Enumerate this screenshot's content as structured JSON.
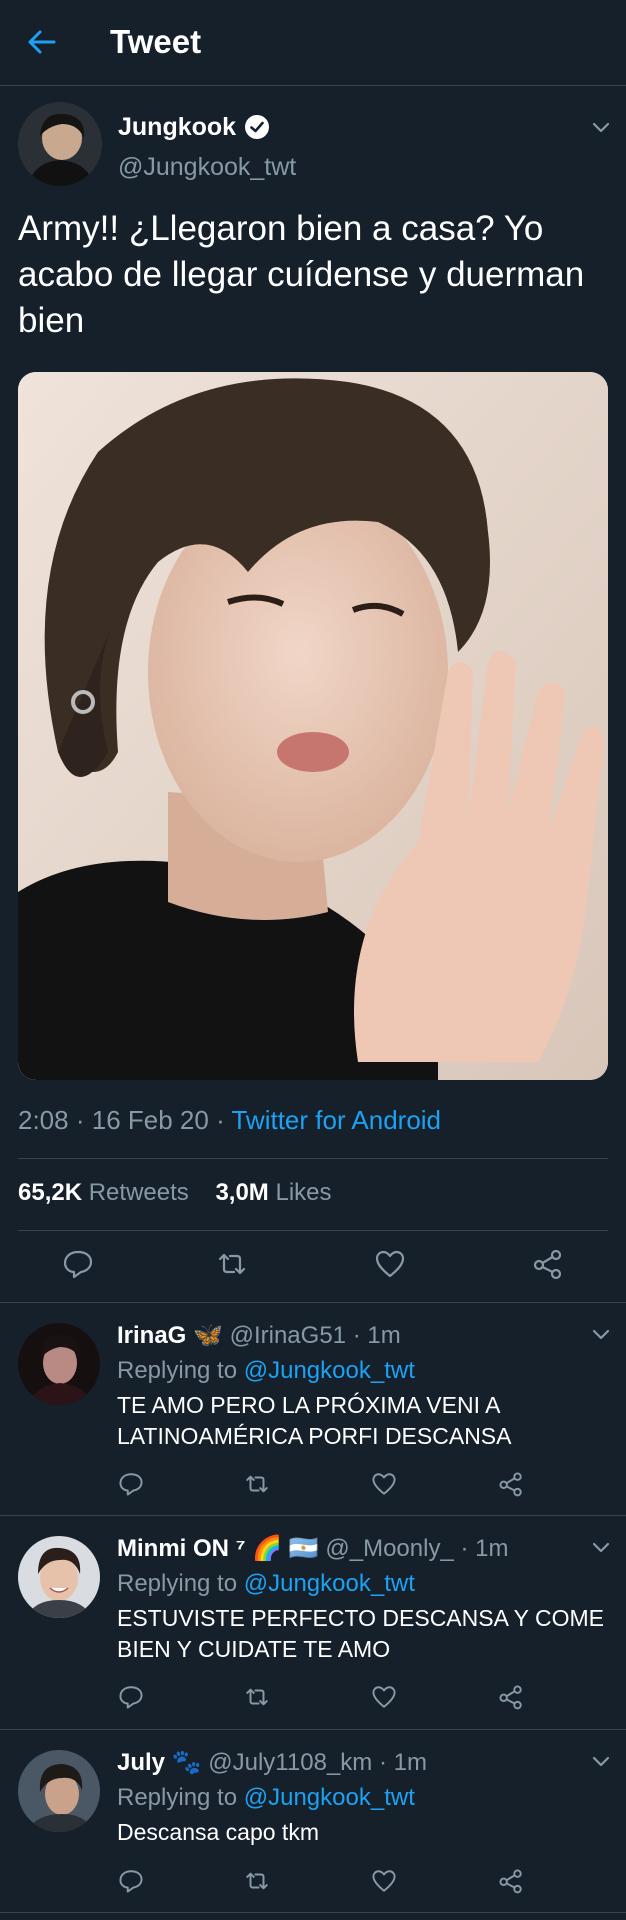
{
  "header": {
    "title": "Tweet",
    "back_icon": "arrow-left-icon"
  },
  "tweet": {
    "name": "Jungkook",
    "handle": "@Jungkook_twt",
    "verified": true,
    "text": "Army!! ¿Llegaron bien a casa? Yo acabo de llegar cuídense y duerman bien",
    "time": "2:08",
    "date": "16 Feb 20",
    "source": "Twitter for Android",
    "retweets_count": "65,2K",
    "retweets_label": "Retweets",
    "likes_count": "3,0M",
    "likes_label": "Likes"
  },
  "replies": [
    {
      "name": "IrinaG",
      "emoji": "🦋",
      "handle": "@IrinaG51",
      "time": "1m",
      "replying_prefix": "Replying to",
      "replying_to": "@Jungkook_twt",
      "text": "TE AMO PERO LA PRÓXIMA VENI A LATINOAMÉRICA PORFI DESCANSA"
    },
    {
      "name": "Minmi ON ⁷",
      "emoji": "🌈 🇦🇷",
      "handle": "@_Moonly_",
      "time": "1m",
      "replying_prefix": "Replying to",
      "replying_to": "@Jungkook_twt",
      "text": "ESTUVISTE PERFECTO DESCANSA Y COME BIEN Y CUIDATE TE AMO"
    },
    {
      "name": "July",
      "emoji": "🐾",
      "handle": "@July1108_km",
      "time": "1m",
      "replying_prefix": "Replying to",
      "replying_to": "@Jungkook_twt",
      "text": "Descansa capo tkm"
    }
  ],
  "colors": {
    "background": "#15202b",
    "accent": "#1da1f2",
    "secondary_text": "#8899a6",
    "divider": "#38444d"
  },
  "icons": {
    "reply": "reply-icon",
    "retweet": "retweet-icon",
    "like": "heart-icon",
    "share": "share-icon",
    "more": "chevron-down-icon"
  }
}
